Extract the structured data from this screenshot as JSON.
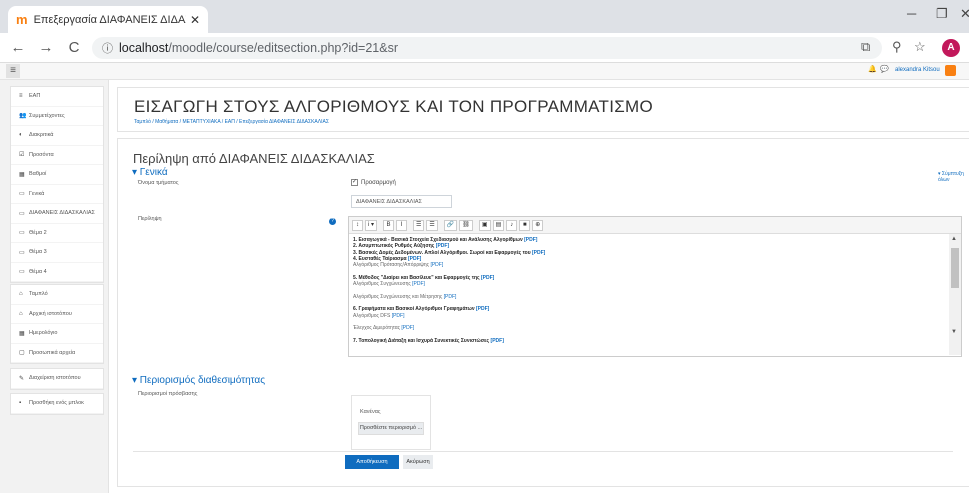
{
  "browser": {
    "tab_title": "Επεξεργασία ΔΙΑΦΑΝΕΙΣ ΔΙΔΑΣΚ",
    "tab_favicon": "m",
    "url_host": "localhost",
    "url_path": "/moodle/course/editsection.php?id=21&sr",
    "profile_initial": "A"
  },
  "header": {
    "user_name": "alexandra Kitsou"
  },
  "sidebar": {
    "block1": [
      {
        "icon": "≡",
        "label": "ΕΑΠ"
      },
      {
        "icon": "👥",
        "label": "Συμμετέχοντες"
      },
      {
        "icon": "◐",
        "label": "Διακριτικά"
      },
      {
        "icon": "☑",
        "label": "Προσόντα"
      },
      {
        "icon": "▦",
        "label": "Βαθμοί"
      },
      {
        "icon": "▭",
        "label": "Γενικά"
      },
      {
        "icon": "▭",
        "label": "ΔΙΑΦΑΝΕΙΣ ΔΙΔΑΣΚΑΛΙΑΣ"
      },
      {
        "icon": "▭",
        "label": "Θέμα 2"
      },
      {
        "icon": "▭",
        "label": "Θέμα 3"
      },
      {
        "icon": "▭",
        "label": "Θέμα 4"
      }
    ],
    "block2": [
      {
        "icon": "⌂",
        "label": "Ταμπλό"
      },
      {
        "icon": "⌂",
        "label": "Αρχική ιστοτόπου"
      },
      {
        "icon": "▦",
        "label": "Ημερολόγιο"
      },
      {
        "icon": "▢",
        "label": "Προσωπικά αρχεία"
      }
    ],
    "block3": [
      {
        "icon": "✎",
        "label": "Διαχείριση ιστοτόπου"
      }
    ],
    "block4": [
      {
        "icon": "▪",
        "label": "Προσθήκη ενός μπλοκ"
      }
    ]
  },
  "page": {
    "course_title": "ΕΙΣΑΓΩΓΗ ΣΤΟΥΣ ΑΛΓΟΡΙΘΜΟΥΣ ΚΑΙ ΤΟΝ ΠΡΟΓΡΑΜΜΑΤΙΣΜΟ",
    "breadcrumb": "Ταμπλό / Μαθήματα / ΜΕΤΑΠΤΥΧΙΑΚΑ / ΕΑΠ / Επεξεργασία ΔΙΑΦΑΝΕΙΣ ΔΙΔΑΣΚΑΛΙΑΣ",
    "section_heading": "Περίληψη από ΔΙΑΦΑΝΕΙΣ ΔΙΔΑΣΚΑΛΙΑΣ",
    "expand_all": "▾ Σύμπτυξη όλων",
    "general_legend": "▾ Γενικά",
    "section_name_label": "Όνομα τμήματος",
    "custom_checkbox": "Προσαρμογή",
    "section_name_value": "ΔΙΑΦΑΝΕΙΣ ΔΙΔΑΣΚΑΛΙΑΣ",
    "summary_label": "Περίληψη",
    "restrict_legend": "▾ Περιορισμός διαθεσιμότητας",
    "access_label": "Περιορισμοί πρόσβασης",
    "none_text": "Κανένας",
    "add_restriction": "Προσθέστε περιορισμό ...",
    "save_button": "Αποθήκευση αλλαγών",
    "cancel_button": "Ακύρωση"
  },
  "editor": {
    "toolbar": [
      "↕",
      "i ▾",
      "B",
      "I",
      "☰",
      "☰",
      "🔗",
      "⛓",
      "▣",
      "▤",
      "♪",
      "■",
      "⊕"
    ],
    "lines": [
      {
        "t": "1. Εισαγωγικά - Βασικά Στοιχεία Σχεδιασμού και Ανάλυσης Αλγορίθμων ",
        "pdf": "[PDF]",
        "cls": "b"
      },
      {
        "t": "2. Ασυμπτωτικός Ρυθμός Αύξησης ",
        "pdf": "[PDF]",
        "cls": "b"
      },
      {
        "t": "3. Βασικές Δομές Δεδομένων. Απλοί Αλγόριθμοι. Σωροί και Εφαρμογές του ",
        "pdf": "[PDF]",
        "cls": "b"
      },
      {
        "t": "4. Ευσταθές Ταίριασμα ",
        "pdf": "[PDF]",
        "cls": "b"
      },
      {
        "t": "Αλγόριθμος Πρότασης/Απόρριψης ",
        "pdf": "[PDF]",
        "cls": "sub"
      },
      {
        "t": "",
        "pdf": "",
        "cls": "sub"
      },
      {
        "t": "5. Μέθοδος \"Διαίρει και Βασίλευε\" και Εφαρμογές της ",
        "pdf": "[PDF]",
        "cls": "b"
      },
      {
        "t": "Αλγόριθμος Συγχώνευσης ",
        "pdf": "[PDF]",
        "cls": "sub"
      },
      {
        "t": "",
        "pdf": "",
        "cls": "sub"
      },
      {
        "t": "Αλγόριθμος Συγχώνευσης και Μέτρησης ",
        "pdf": "[PDF]",
        "cls": "sub"
      },
      {
        "t": "",
        "pdf": "",
        "cls": "sub"
      },
      {
        "t": "6. Γραφήματα και Βασικοί Αλγόριθμοι Γραφημάτων ",
        "pdf": "[PDF]",
        "cls": "b"
      },
      {
        "t": "Αλγόριθμος DFS ",
        "pdf": "[PDF]",
        "cls": "sub"
      },
      {
        "t": "",
        "pdf": "",
        "cls": "sub"
      },
      {
        "t": "Έλεγχος Διμερότητας ",
        "pdf": "[PDF]",
        "cls": "sub"
      },
      {
        "t": "",
        "pdf": "",
        "cls": "sub"
      },
      {
        "t": "7. Τοπολογική Διάταξη και Ισχυρά Συνεκτικές Συνιστώσες ",
        "pdf": "[PDF]",
        "cls": "b"
      }
    ]
  },
  "colors": {
    "accent": "#0f6cbf",
    "brand": "#f98012"
  }
}
